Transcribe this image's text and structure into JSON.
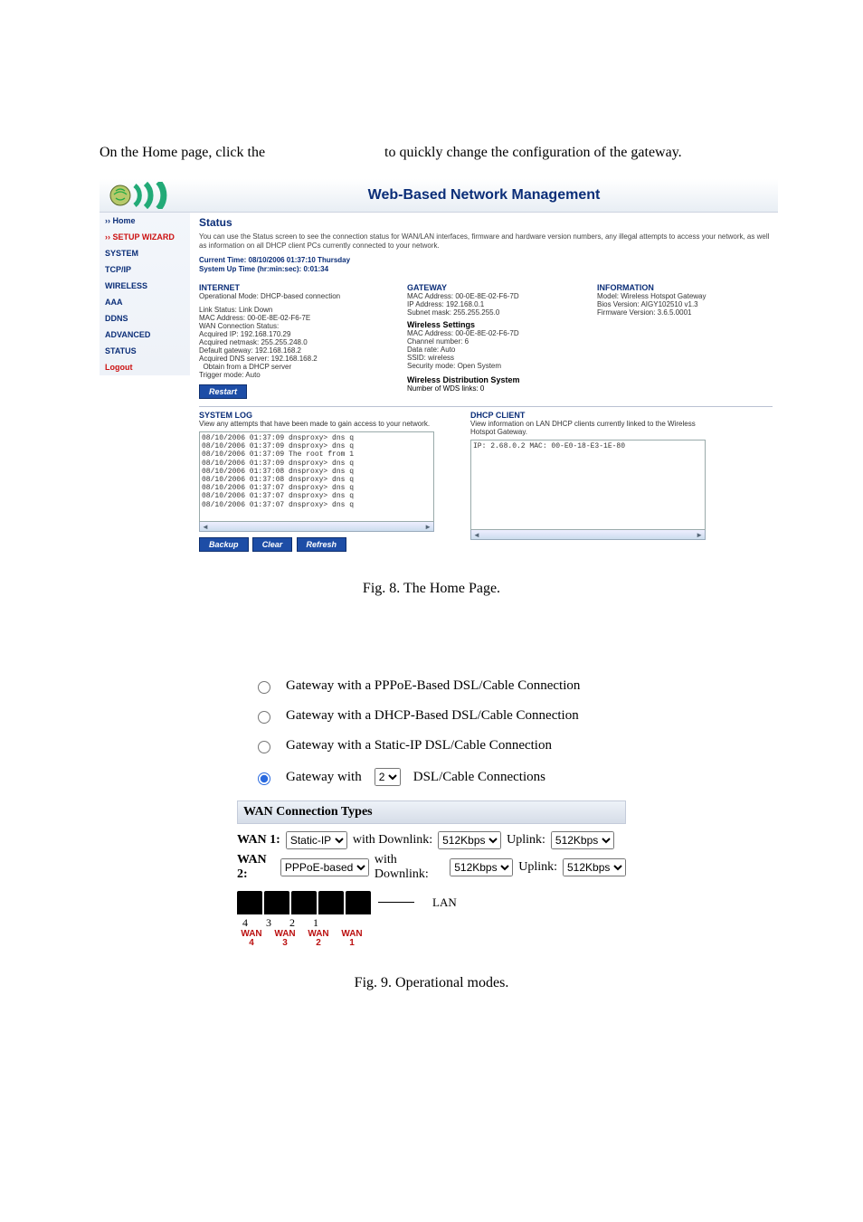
{
  "intro": {
    "before": "On the Home page, click the",
    "after": "to quickly change the configuration of the gateway."
  },
  "admin": {
    "title": "Web-Based Network Management",
    "nav": [
      {
        "label": "›› Home",
        "hot": false
      },
      {
        "label": "›› SETUP WIZARD",
        "hot": true
      },
      {
        "label": "SYSTEM",
        "hot": false
      },
      {
        "label": "TCP/IP",
        "hot": false
      },
      {
        "label": "WIRELESS",
        "hot": false
      },
      {
        "label": "AAA",
        "hot": false
      },
      {
        "label": "DDNS",
        "hot": false
      },
      {
        "label": "ADVANCED",
        "hot": false
      },
      {
        "label": "STATUS",
        "hot": false
      },
      {
        "label": "Logout",
        "hot": true
      }
    ],
    "status_heading": "Status",
    "status_blurb": "You can use the Status screen to see the connection status for WAN/LAN interfaces, firmware and hardware version numbers, any illegal attempts to access your network, as well as information on all DHCP client PCs currently connected to your network.",
    "current_time_label": "Current Time:",
    "current_time": "08/10/2006 01:37:10 Thursday",
    "uptime_label": "System Up Time (hr:min:sec):",
    "uptime": "0:01:34",
    "internet": {
      "heading": "INTERNET",
      "op_mode": "Operational Mode: DHCP-based connection",
      "link_status": "Link Status: Link Down",
      "mac": "MAC Address: 00-0E-8E-02-F6-7E",
      "wan_conn": "WAN Connection Status:",
      "acq_ip": "Acquired IP: 192.168.170.29",
      "acq_mask": "Acquired netmask: 255.255.248.0",
      "def_gw": "Default gateway: 192.168.168.2",
      "dns": "Acquired DNS server: 192.168.168.2",
      "dns_src": "  Obtain from a DHCP server",
      "trigger": "Trigger mode: Auto"
    },
    "gateway": {
      "heading": "GATEWAY",
      "mac": "MAC Address: 00-0E-8E-02-F6-7D",
      "ip": "IP Address: 192.168.0.1",
      "mask": "Subnet mask: 255.255.255.0",
      "wifi_heading": "Wireless Settings",
      "wmac": "MAC Address: 00-0E-8E-02-F6-7D",
      "chan": "Channel number: 6",
      "rate": "Data rate: Auto",
      "ssid": "SSID: wireless",
      "sec": "Security mode: Open System",
      "wds_heading": "Wireless Distribution System",
      "wds_links": "Number of WDS links: 0"
    },
    "info": {
      "heading": "INFORMATION",
      "model": "Model: Wireless Hotspot Gateway",
      "bios": "Bios Version: AIGY102510 v1.3",
      "fw": "Firmware Version: 3.6.5.0001"
    },
    "restart_btn": "Restart",
    "syslog_heading": "SYSTEM LOG",
    "syslog_desc": "View any attempts that have been made to gain access to your network.",
    "syslog_lines": "08/10/2006 01:37:09 dnsproxy> dns q\n08/10/2006 01:37:09 dnsproxy> dns q\n08/10/2006 01:37:09 The root from 1\n08/10/2006 01:37:09 dnsproxy> dns q\n08/10/2006 01:37:08 dnsproxy> dns q\n08/10/2006 01:37:08 dnsproxy> dns q\n08/10/2006 01:37:07 dnsproxy> dns q\n08/10/2006 01:37:07 dnsproxy> dns q\n08/10/2006 01:37:07 dnsproxy> dns q",
    "dhcp_heading": "DHCP CLIENT",
    "dhcp_desc": "View information on LAN DHCP clients currently linked to the Wireless Hotspot Gateway.",
    "dhcp_lines": "IP: 2.68.0.2 MAC: 00-E0-18-E3-1E-80",
    "btn_backup": "Backup",
    "btn_clear": "Clear",
    "btn_refresh": "Refresh"
  },
  "fig8": "Fig. 8. The Home Page.",
  "modes": {
    "opts": [
      "Gateway with a PPPoE-Based DSL/Cable Connection",
      "Gateway with a DHCP-Based DSL/Cable Connection",
      "Gateway with a Static-IP DSL/Cable Connection"
    ],
    "opt4_pre": "Gateway with",
    "opt4_sel": "2",
    "opt4_post": "DSL/Cable Connections",
    "sec_heading": "WAN Connection Types",
    "wan1_label": "WAN 1:",
    "wan2_label": "WAN 2:",
    "wan1_type": "Static-IP",
    "wan2_type": "PPPoE-based",
    "with_dl": "with Downlink:",
    "uplink": "Uplink:",
    "rate": "512Kbps",
    "port_nums": [
      "4",
      "3",
      "2",
      "1"
    ],
    "lan_label": "LAN",
    "wan_lbls": [
      "WAN\n4",
      "WAN\n3",
      "WAN\n2",
      "WAN\n1"
    ]
  },
  "fig9": "Fig. 9. Operational modes."
}
